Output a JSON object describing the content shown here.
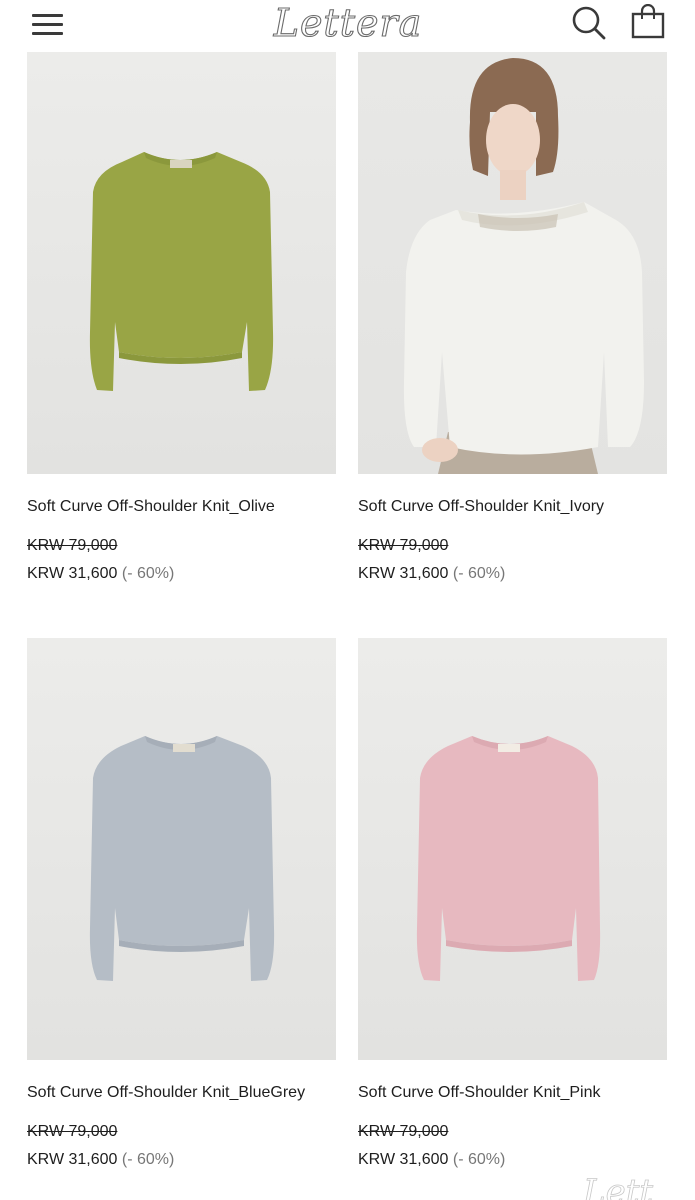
{
  "header": {
    "logo": "Lettera",
    "menu_icon": "hamburger-menu-icon",
    "search_icon": "search-icon",
    "cart_icon": "shopping-bag-icon"
  },
  "colors": {
    "olive": "#99a545",
    "ivory": "#f2f2ee",
    "bluegrey": "#b5bdc6",
    "pink": "#e7b9c0"
  },
  "products": [
    {
      "name": "Soft Curve Off-Shoulder Knit_Olive",
      "original_price": "KRW 79,000",
      "price": "KRW 31,600",
      "discount": "(- 60%)"
    },
    {
      "name": "Soft Curve Off-Shoulder Knit_Ivory",
      "original_price": "KRW 79,000",
      "price": "KRW 31,600",
      "discount": "(- 60%)"
    },
    {
      "name": "Soft Curve Off-Shoulder Knit_BlueGrey",
      "original_price": "KRW 79,000",
      "price": "KRW 31,600",
      "discount": "(- 60%)"
    },
    {
      "name": "Soft Curve Off-Shoulder Knit_Pink",
      "original_price": "KRW 79,000",
      "price": "KRW 31,600",
      "discount": "(- 60%)"
    }
  ]
}
